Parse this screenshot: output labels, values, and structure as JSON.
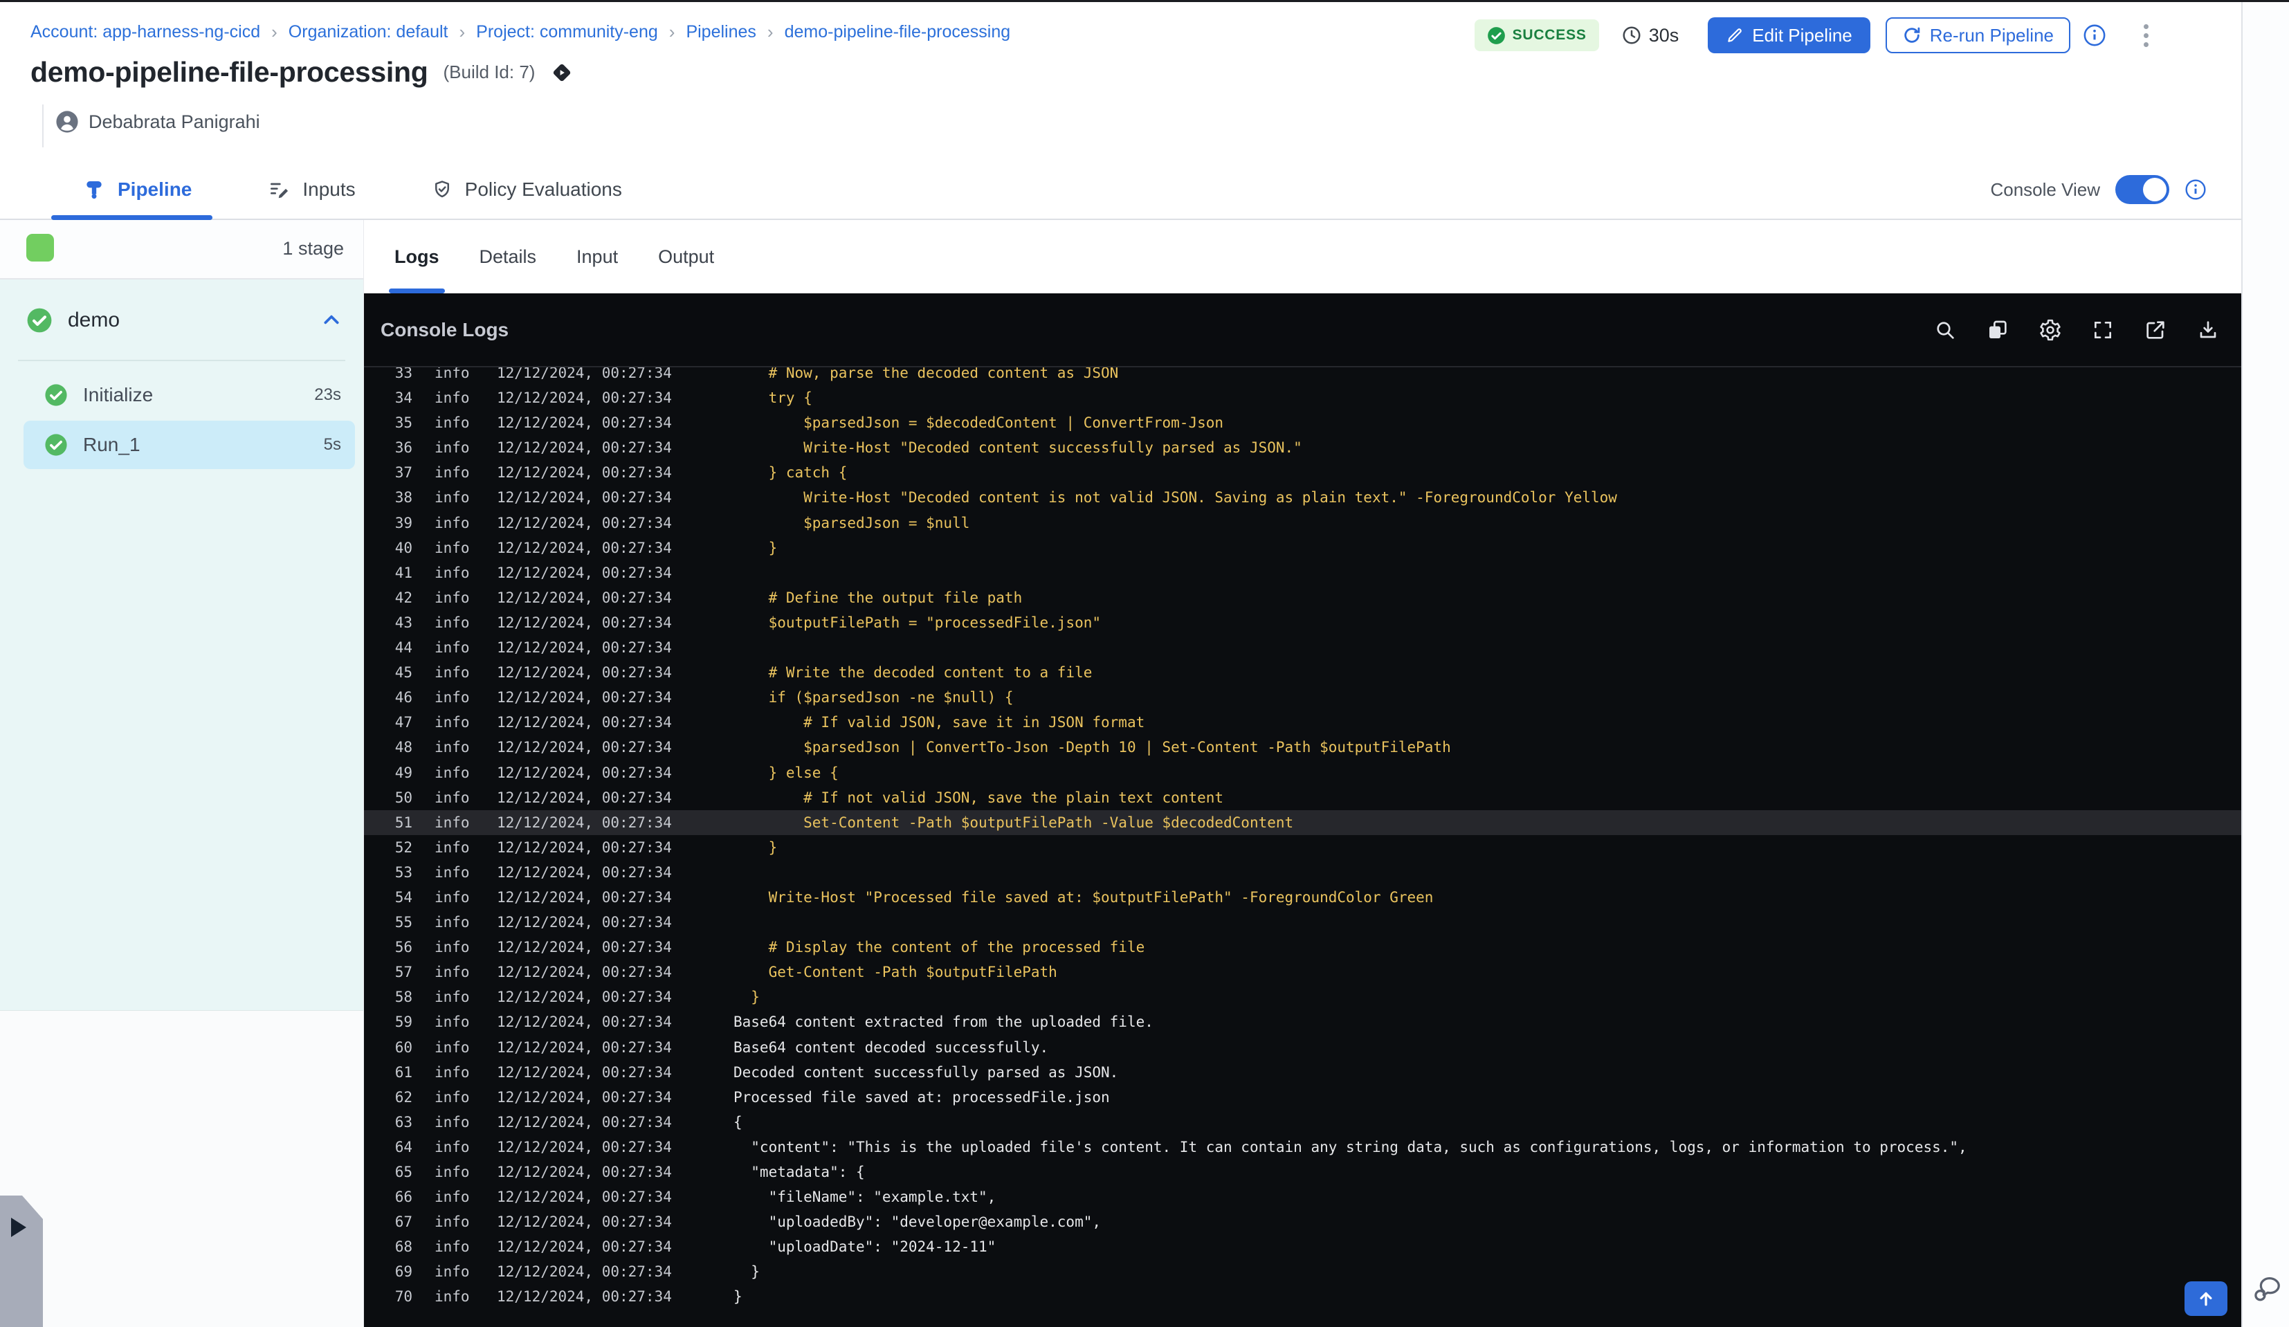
{
  "colors": {
    "accent": "#2d6bdb",
    "success_text": "#1a8040",
    "success_bg": "#e5f7e1",
    "stage_green": "#72ce60",
    "selected_step_bg": "#ccecf9",
    "stage_section_bg": "#e9f6f6",
    "console_bg": "#0b0d10",
    "log_yellow": "#eac35e",
    "log_white": "#e6e7e9",
    "highlight_row_bg": "#26272c"
  },
  "breadcrumb": {
    "separator": "›",
    "items": [
      "Account: app-harness-ng-cicd",
      "Organization: default",
      "Project: community-eng",
      "Pipelines",
      "demo-pipeline-file-processing"
    ]
  },
  "header": {
    "status": "SUCCESS",
    "duration": "30s",
    "edit_button": "Edit Pipeline",
    "rerun_button": "Re-run Pipeline",
    "title": "demo-pipeline-file-processing",
    "build_id": "(Build Id: 7)",
    "user": "Debabrata Panigrahi"
  },
  "view_tabs": {
    "items": [
      "Pipeline",
      "Inputs",
      "Policy Evaluations"
    ],
    "active": "Pipeline",
    "console_view_label": "Console View",
    "console_view_on": true
  },
  "sidebar": {
    "stage_count": "1 stage",
    "stage": {
      "name": "demo",
      "status": "success"
    },
    "steps": [
      {
        "name": "Initialize",
        "duration": "23s",
        "selected": false
      },
      {
        "name": "Run_1",
        "duration": "5s",
        "selected": true
      }
    ]
  },
  "console": {
    "tabs": [
      "Logs",
      "Details",
      "Input",
      "Output"
    ],
    "active_tab": "Logs",
    "title": "Console Logs",
    "toolbar_icons": [
      "search-icon",
      "copy-icon",
      "settings-icon",
      "fullscreen-icon",
      "open-in-new-icon",
      "download-icon"
    ],
    "scroll_top_icon": "arrow-up-icon",
    "logs": [
      {
        "n": 33,
        "level": "info",
        "ts": "12/12/2024, 00:27:34",
        "style": "yellow",
        "highlight": false,
        "msg": "    # Now, parse the decoded content as JSON"
      },
      {
        "n": 34,
        "level": "info",
        "ts": "12/12/2024, 00:27:34",
        "style": "yellow",
        "highlight": false,
        "msg": "    try {"
      },
      {
        "n": 35,
        "level": "info",
        "ts": "12/12/2024, 00:27:34",
        "style": "yellow",
        "highlight": false,
        "msg": "        $parsedJson = $decodedContent | ConvertFrom-Json"
      },
      {
        "n": 36,
        "level": "info",
        "ts": "12/12/2024, 00:27:34",
        "style": "yellow",
        "highlight": false,
        "msg": "        Write-Host \"Decoded content successfully parsed as JSON.\""
      },
      {
        "n": 37,
        "level": "info",
        "ts": "12/12/2024, 00:27:34",
        "style": "yellow",
        "highlight": false,
        "msg": "    } catch {"
      },
      {
        "n": 38,
        "level": "info",
        "ts": "12/12/2024, 00:27:34",
        "style": "yellow",
        "highlight": false,
        "msg": "        Write-Host \"Decoded content is not valid JSON. Saving as plain text.\" -ForegroundColor Yellow"
      },
      {
        "n": 39,
        "level": "info",
        "ts": "12/12/2024, 00:27:34",
        "style": "yellow",
        "highlight": false,
        "msg": "        $parsedJson = $null"
      },
      {
        "n": 40,
        "level": "info",
        "ts": "12/12/2024, 00:27:34",
        "style": "yellow",
        "highlight": false,
        "msg": "    }"
      },
      {
        "n": 41,
        "level": "info",
        "ts": "12/12/2024, 00:27:34",
        "style": "yellow",
        "highlight": false,
        "msg": ""
      },
      {
        "n": 42,
        "level": "info",
        "ts": "12/12/2024, 00:27:34",
        "style": "yellow",
        "highlight": false,
        "msg": "    # Define the output file path"
      },
      {
        "n": 43,
        "level": "info",
        "ts": "12/12/2024, 00:27:34",
        "style": "yellow",
        "highlight": false,
        "msg": "    $outputFilePath = \"processedFile.json\""
      },
      {
        "n": 44,
        "level": "info",
        "ts": "12/12/2024, 00:27:34",
        "style": "yellow",
        "highlight": false,
        "msg": ""
      },
      {
        "n": 45,
        "level": "info",
        "ts": "12/12/2024, 00:27:34",
        "style": "yellow",
        "highlight": false,
        "msg": "    # Write the decoded content to a file"
      },
      {
        "n": 46,
        "level": "info",
        "ts": "12/12/2024, 00:27:34",
        "style": "yellow",
        "highlight": false,
        "msg": "    if ($parsedJson -ne $null) {"
      },
      {
        "n": 47,
        "level": "info",
        "ts": "12/12/2024, 00:27:34",
        "style": "yellow",
        "highlight": false,
        "msg": "        # If valid JSON, save it in JSON format"
      },
      {
        "n": 48,
        "level": "info",
        "ts": "12/12/2024, 00:27:34",
        "style": "yellow",
        "highlight": false,
        "msg": "        $parsedJson | ConvertTo-Json -Depth 10 | Set-Content -Path $outputFilePath"
      },
      {
        "n": 49,
        "level": "info",
        "ts": "12/12/2024, 00:27:34",
        "style": "yellow",
        "highlight": false,
        "msg": "    } else {"
      },
      {
        "n": 50,
        "level": "info",
        "ts": "12/12/2024, 00:27:34",
        "style": "yellow",
        "highlight": false,
        "msg": "        # If not valid JSON, save the plain text content"
      },
      {
        "n": 51,
        "level": "info",
        "ts": "12/12/2024, 00:27:34",
        "style": "yellow",
        "highlight": true,
        "msg": "        Set-Content -Path $outputFilePath -Value $decodedContent"
      },
      {
        "n": 52,
        "level": "info",
        "ts": "12/12/2024, 00:27:34",
        "style": "yellow",
        "highlight": false,
        "msg": "    }"
      },
      {
        "n": 53,
        "level": "info",
        "ts": "12/12/2024, 00:27:34",
        "style": "yellow",
        "highlight": false,
        "msg": ""
      },
      {
        "n": 54,
        "level": "info",
        "ts": "12/12/2024, 00:27:34",
        "style": "yellow",
        "highlight": false,
        "msg": "    Write-Host \"Processed file saved at: $outputFilePath\" -ForegroundColor Green"
      },
      {
        "n": 55,
        "level": "info",
        "ts": "12/12/2024, 00:27:34",
        "style": "yellow",
        "highlight": false,
        "msg": ""
      },
      {
        "n": 56,
        "level": "info",
        "ts": "12/12/2024, 00:27:34",
        "style": "yellow",
        "highlight": false,
        "msg": "    # Display the content of the processed file"
      },
      {
        "n": 57,
        "level": "info",
        "ts": "12/12/2024, 00:27:34",
        "style": "yellow",
        "highlight": false,
        "msg": "    Get-Content -Path $outputFilePath"
      },
      {
        "n": 58,
        "level": "info",
        "ts": "12/12/2024, 00:27:34",
        "style": "yellow",
        "highlight": false,
        "msg": "  }"
      },
      {
        "n": 59,
        "level": "info",
        "ts": "12/12/2024, 00:27:34",
        "style": "white",
        "highlight": false,
        "msg": "Base64 content extracted from the uploaded file."
      },
      {
        "n": 60,
        "level": "info",
        "ts": "12/12/2024, 00:27:34",
        "style": "white",
        "highlight": false,
        "msg": "Base64 content decoded successfully."
      },
      {
        "n": 61,
        "level": "info",
        "ts": "12/12/2024, 00:27:34",
        "style": "white",
        "highlight": false,
        "msg": "Decoded content successfully parsed as JSON."
      },
      {
        "n": 62,
        "level": "info",
        "ts": "12/12/2024, 00:27:34",
        "style": "white",
        "highlight": false,
        "msg": "Processed file saved at: processedFile.json"
      },
      {
        "n": 63,
        "level": "info",
        "ts": "12/12/2024, 00:27:34",
        "style": "white",
        "highlight": false,
        "msg": "{"
      },
      {
        "n": 64,
        "level": "info",
        "ts": "12/12/2024, 00:27:34",
        "style": "white",
        "highlight": false,
        "msg": "  \"content\": \"This is the uploaded file's content. It can contain any string data, such as configurations, logs, or information to process.\","
      },
      {
        "n": 65,
        "level": "info",
        "ts": "12/12/2024, 00:27:34",
        "style": "white",
        "highlight": false,
        "msg": "  \"metadata\": {"
      },
      {
        "n": 66,
        "level": "info",
        "ts": "12/12/2024, 00:27:34",
        "style": "white",
        "highlight": false,
        "msg": "    \"fileName\": \"example.txt\","
      },
      {
        "n": 67,
        "level": "info",
        "ts": "12/12/2024, 00:27:34",
        "style": "white",
        "highlight": false,
        "msg": "    \"uploadedBy\": \"developer@example.com\","
      },
      {
        "n": 68,
        "level": "info",
        "ts": "12/12/2024, 00:27:34",
        "style": "white",
        "highlight": false,
        "msg": "    \"uploadDate\": \"2024-12-11\""
      },
      {
        "n": 69,
        "level": "info",
        "ts": "12/12/2024, 00:27:34",
        "style": "white",
        "highlight": false,
        "msg": "  }"
      },
      {
        "n": 70,
        "level": "info",
        "ts": "12/12/2024, 00:27:34",
        "style": "white",
        "highlight": false,
        "msg": "}"
      }
    ]
  }
}
